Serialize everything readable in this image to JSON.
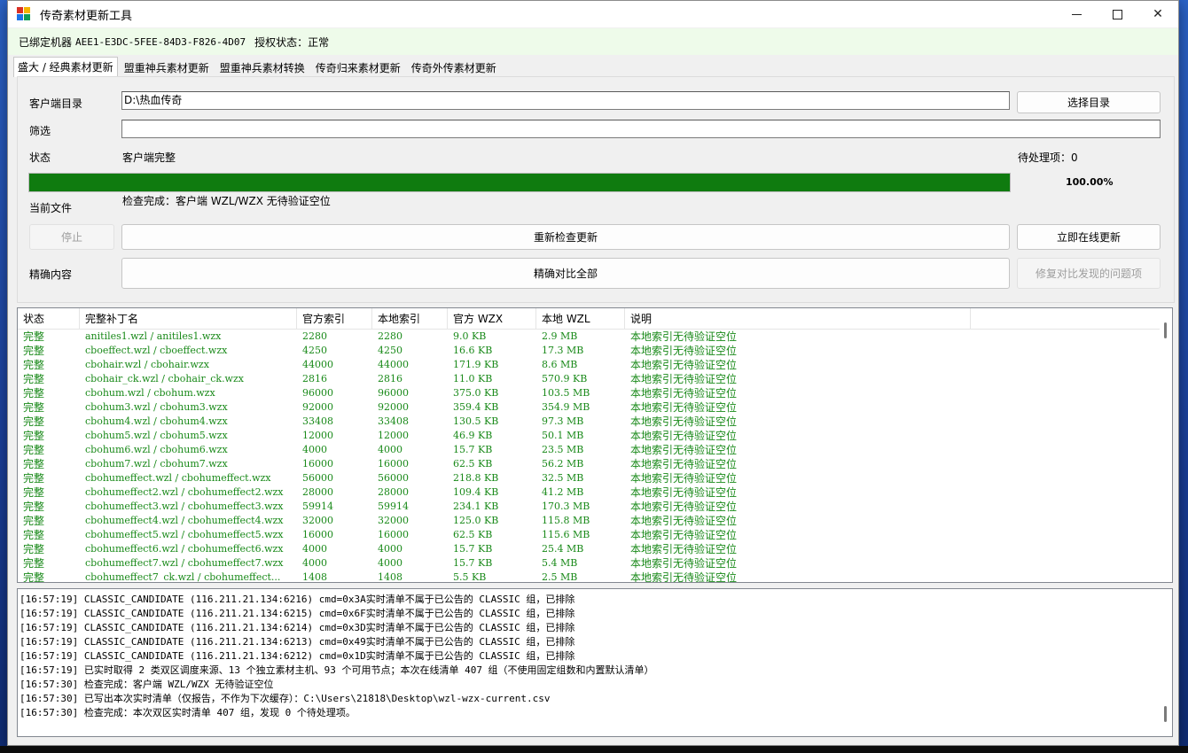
{
  "window": {
    "title": "传奇素材更新工具",
    "minimize": "–",
    "close": "✕"
  },
  "binding": {
    "label": "已绑定机器",
    "machine_id": "AEE1-E3DC-5FEE-84D3-F826-4D07",
    "auth_label": "授权状态：正常"
  },
  "tabs": [
    {
      "label": "盛大 / 经典素材更新",
      "active": true
    },
    {
      "label": "盟重神兵素材更新",
      "active": false
    },
    {
      "label": "盟重神兵素材转换",
      "active": false
    },
    {
      "label": "传奇归来素材更新",
      "active": false
    },
    {
      "label": "传奇外传素材更新",
      "active": false
    }
  ],
  "form": {
    "client_dir_label": "客户端目录",
    "client_dir_value": "D:\\热血传奇",
    "choose_dir_button": "选择目录",
    "filter_label": "筛选",
    "filter_value": "",
    "status_label": "状态",
    "status_value": "客户端完整",
    "pending_label": "待处理项：0",
    "progress_percent": 100,
    "progress_text": "100.00%",
    "current_file_label": "当前文件",
    "current_file_value": "检查完成：客户端 WZL/WZX 无待验证空位",
    "stop_button": "停止",
    "recheck_button": "重新检查更新",
    "online_update_button": "立即在线更新",
    "exact_label": "精确内容",
    "exact_compare_button": "精确对比全部",
    "fix_button": "修复对比发现的问题项"
  },
  "table": {
    "columns": [
      "状态",
      "完整补丁名",
      "官方索引",
      "本地索引",
      "官方 WZX",
      "本地 WZL",
      "说明"
    ],
    "rows": [
      [
        "完整",
        "anitiles1.wzl / anitiles1.wzx",
        "2280",
        "2280",
        "9.0 KB",
        "2.9 MB",
        "本地索引无待验证空位"
      ],
      [
        "完整",
        "cboeffect.wzl / cboeffect.wzx",
        "4250",
        "4250",
        "16.6 KB",
        "17.3 MB",
        "本地索引无待验证空位"
      ],
      [
        "完整",
        "cbohair.wzl / cbohair.wzx",
        "44000",
        "44000",
        "171.9 KB",
        "8.6 MB",
        "本地索引无待验证空位"
      ],
      [
        "完整",
        "cbohair_ck.wzl / cbohair_ck.wzx",
        "2816",
        "2816",
        "11.0 KB",
        "570.9 KB",
        "本地索引无待验证空位"
      ],
      [
        "完整",
        "cbohum.wzl / cbohum.wzx",
        "96000",
        "96000",
        "375.0 KB",
        "103.5 MB",
        "本地索引无待验证空位"
      ],
      [
        "完整",
        "cbohum3.wzl / cbohum3.wzx",
        "92000",
        "92000",
        "359.4 KB",
        "354.9 MB",
        "本地索引无待验证空位"
      ],
      [
        "完整",
        "cbohum4.wzl / cbohum4.wzx",
        "33408",
        "33408",
        "130.5 KB",
        "97.3 MB",
        "本地索引无待验证空位"
      ],
      [
        "完整",
        "cbohum5.wzl / cbohum5.wzx",
        "12000",
        "12000",
        "46.9 KB",
        "50.1 MB",
        "本地索引无待验证空位"
      ],
      [
        "完整",
        "cbohum6.wzl / cbohum6.wzx",
        "4000",
        "4000",
        "15.7 KB",
        "23.5 MB",
        "本地索引无待验证空位"
      ],
      [
        "完整",
        "cbohum7.wzl / cbohum7.wzx",
        "16000",
        "16000",
        "62.5 KB",
        "56.2 MB",
        "本地索引无待验证空位"
      ],
      [
        "完整",
        "cbohumeffect.wzl / cbohumeffect.wzx",
        "56000",
        "56000",
        "218.8 KB",
        "32.5 MB",
        "本地索引无待验证空位"
      ],
      [
        "完整",
        "cbohumeffect2.wzl / cbohumeffect2.wzx",
        "28000",
        "28000",
        "109.4 KB",
        "41.2 MB",
        "本地索引无待验证空位"
      ],
      [
        "完整",
        "cbohumeffect3.wzl / cbohumeffect3.wzx",
        "59914",
        "59914",
        "234.1 KB",
        "170.3 MB",
        "本地索引无待验证空位"
      ],
      [
        "完整",
        "cbohumeffect4.wzl / cbohumeffect4.wzx",
        "32000",
        "32000",
        "125.0 KB",
        "115.8 MB",
        "本地索引无待验证空位"
      ],
      [
        "完整",
        "cbohumeffect5.wzl / cbohumeffect5.wzx",
        "16000",
        "16000",
        "62.5 KB",
        "115.6 MB",
        "本地索引无待验证空位"
      ],
      [
        "完整",
        "cbohumeffect6.wzl / cbohumeffect6.wzx",
        "4000",
        "4000",
        "15.7 KB",
        "25.4 MB",
        "本地索引无待验证空位"
      ],
      [
        "完整",
        "cbohumeffect7.wzl / cbohumeffect7.wzx",
        "4000",
        "4000",
        "15.7 KB",
        "5.4 MB",
        "本地索引无待验证空位"
      ],
      [
        "完整",
        "cbohumeffect7_ck.wzl / cbohumeffect...",
        "1408",
        "1408",
        "5.5 KB",
        "2.5 MB",
        "本地索引无待验证空位"
      ]
    ]
  },
  "log": [
    "[16:57:19] CLASSIC_CANDIDATE (116.211.21.134:6216) cmd=0x3A实时清单不属于已公告的 CLASSIC 组，已排除",
    "[16:57:19] CLASSIC_CANDIDATE (116.211.21.134:6215) cmd=0x6F实时清单不属于已公告的 CLASSIC 组，已排除",
    "[16:57:19] CLASSIC_CANDIDATE (116.211.21.134:6214) cmd=0x3D实时清单不属于已公告的 CLASSIC 组，已排除",
    "[16:57:19] CLASSIC_CANDIDATE (116.211.21.134:6213) cmd=0x49实时清单不属于已公告的 CLASSIC 组，已排除",
    "[16:57:19] CLASSIC_CANDIDATE (116.211.21.134:6212) cmd=0x1D实时清单不属于已公告的 CLASSIC 组，已排除",
    "[16:57:19] 已实时取得 2 类双区调度来源、13 个独立素材主机、93 个可用节点；本次在线清单 407 组（不使用固定组数和内置默认清单）",
    "[16:57:30] 检查完成：客户端 WZL/WZX 无待验证空位",
    "[16:57:30] 已写出本次实时清单（仅报告，不作为下次缓存）：C:\\Users\\21818\\Desktop\\wzl-wzx-current.csv",
    "[16:57:30] 检查完成：本次双区实时清单 407 组，发现 0 个待处理项。"
  ],
  "colors": {
    "progress_fill": "#0f7b0f",
    "row_text": "#1a8a1a",
    "bind_bar": "#eefbea"
  }
}
